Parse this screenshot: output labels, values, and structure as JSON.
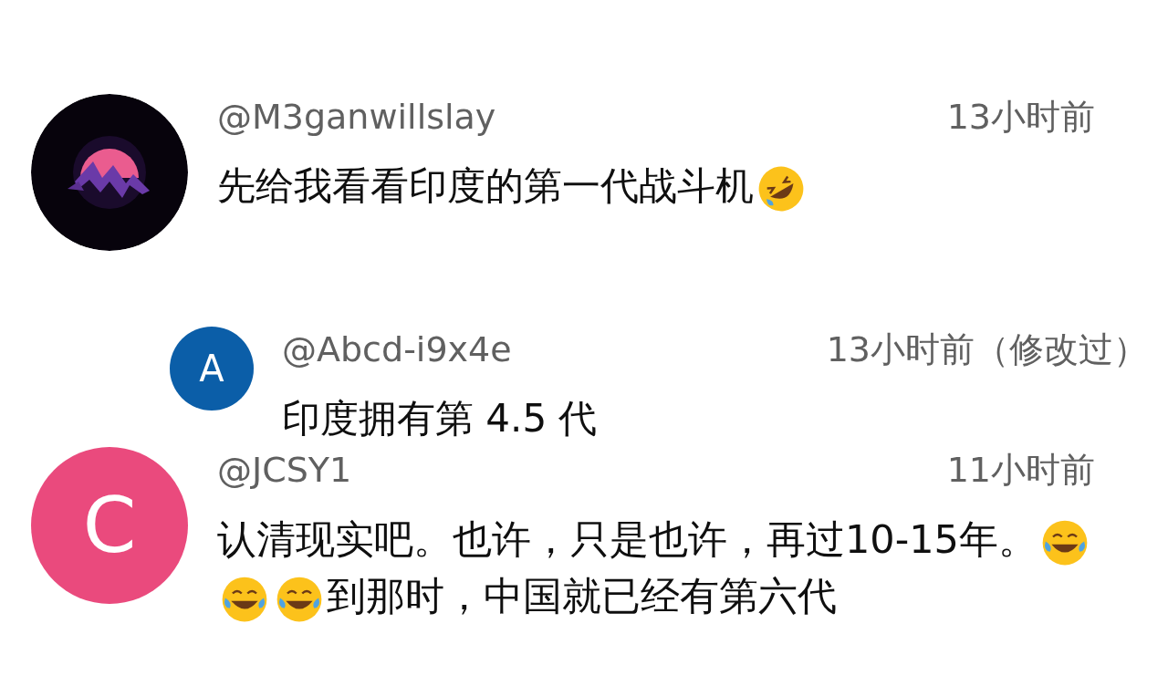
{
  "comments": [
    {
      "avatar": {
        "kind": "picture"
      },
      "author": "@M3ganwillslay",
      "time": "13小时前",
      "body": [
        {
          "kind": "text",
          "text": "先给我看看印度的第一代战斗机"
        },
        {
          "kind": "rofl"
        }
      ],
      "replies": [
        {
          "avatar": {
            "kind": "letter",
            "letter": "A",
            "color": "#0b5ea8"
          },
          "author": "@Abcd-i9x4e",
          "time": "13小时前（修改过）",
          "body": [
            {
              "kind": "text",
              "text": "印度拥有第 4.5 代"
            }
          ]
        }
      ]
    },
    {
      "avatar": {
        "kind": "letter",
        "letter": "C",
        "color": "#ea4a7d"
      },
      "author": "@JCSY1",
      "time": "11小时前",
      "body": [
        {
          "kind": "text",
          "text": "认清现实吧。也许，只是也许，再过10-15年。"
        },
        {
          "kind": "tears"
        },
        {
          "kind": "tears"
        },
        {
          "kind": "tears"
        },
        {
          "kind": "text",
          "text": "到那时，中国就已经有第六代"
        }
      ]
    }
  ]
}
